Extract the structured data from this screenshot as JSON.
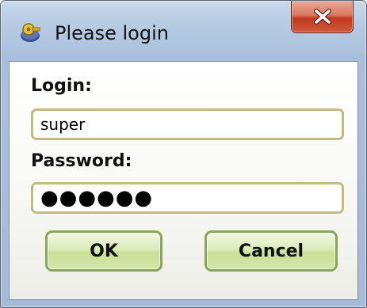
{
  "window": {
    "title": "Please login",
    "app_icon": "key-lock-icon",
    "close_icon": "close-icon"
  },
  "form": {
    "login_label": "Login:",
    "login_value": "super",
    "password_label": "Password:",
    "password_value": "●●●●●●"
  },
  "buttons": {
    "ok_label": "OK",
    "cancel_label": "Cancel"
  },
  "colors": {
    "close_button": "#c9452a",
    "field_border": "#c3bb86",
    "button_green": "#c9e09a"
  }
}
